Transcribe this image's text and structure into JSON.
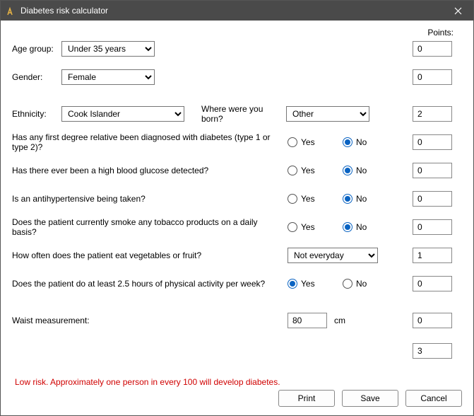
{
  "window": {
    "title": "Diabetes risk calculator"
  },
  "header": {
    "points_label": "Points:"
  },
  "labels": {
    "age_group": "Age group:",
    "gender": "Gender:",
    "ethnicity": "Ethnicity:",
    "where_born": "Where were you born?",
    "relative": "Has any first degree relative been diagnosed with diabetes (type 1 or type 2)?",
    "high_glucose": "Has there ever been a high blood glucose detected?",
    "antihyp": "Is an antihypertensive being taken?",
    "smoke": "Does the patient currently smoke any tobacco products on a daily basis?",
    "veg": "How often does the patient eat vegetables or fruit?",
    "activity": "Does the patient do at least 2.5 hours of physical activity per week?",
    "waist": "Waist measurement:",
    "cm": "cm",
    "yes": "Yes",
    "no": "No"
  },
  "values": {
    "age_group": "Under 35 years",
    "gender": "Female",
    "ethnicity": "Cook Islander",
    "where_born": "Other",
    "relative": "No",
    "high_glucose": "No",
    "antihyp": "No",
    "smoke": "No",
    "veg": "Not everyday",
    "activity": "Yes",
    "waist": "80"
  },
  "points": {
    "age_group": "0",
    "gender": "0",
    "ethnicity_born": "2",
    "relative": "0",
    "high_glucose": "0",
    "antihyp": "0",
    "smoke": "0",
    "veg": "1",
    "activity": "0",
    "waist": "0",
    "total": "3"
  },
  "risk_message": "Low risk. Approximately one person in every 100 will develop diabetes.",
  "buttons": {
    "print": "Print",
    "save": "Save",
    "cancel": "Cancel"
  }
}
